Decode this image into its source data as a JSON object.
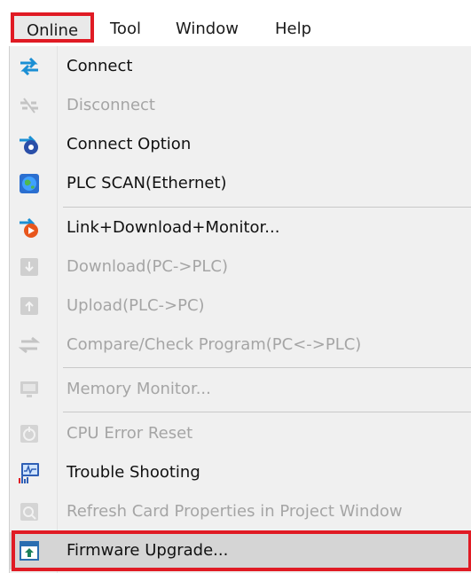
{
  "menubar": {
    "items": [
      {
        "label": "Online"
      },
      {
        "label": "Tool"
      },
      {
        "label": "Window"
      },
      {
        "label": "Help"
      }
    ]
  },
  "menu": {
    "items": [
      {
        "label": "Connect",
        "enabled": true,
        "icon": "connect-arrows-icon"
      },
      {
        "label": "Disconnect",
        "enabled": false,
        "icon": "disconnect-icon"
      },
      {
        "label": "Connect Option",
        "enabled": true,
        "icon": "connect-option-icon"
      },
      {
        "label": "PLC SCAN(Ethernet)",
        "enabled": true,
        "icon": "globe-icon"
      },
      {
        "label": "Link+Download+Monitor...",
        "enabled": true,
        "icon": "link-download-monitor-icon"
      },
      {
        "label": "Download(PC->PLC)",
        "enabled": false,
        "icon": "download-icon"
      },
      {
        "label": "Upload(PLC->PC)",
        "enabled": false,
        "icon": "upload-icon"
      },
      {
        "label": "Compare/Check Program(PC<->PLC)",
        "enabled": false,
        "icon": "compare-icon"
      },
      {
        "label": "Memory Monitor...",
        "enabled": false,
        "icon": "monitor-icon"
      },
      {
        "label": "CPU Error Reset",
        "enabled": false,
        "icon": "reset-icon"
      },
      {
        "label": "Trouble Shooting",
        "enabled": true,
        "icon": "trouble-shooting-icon"
      },
      {
        "label": "Refresh Card Properties in Project Window",
        "enabled": false,
        "icon": "refresh-card-icon"
      },
      {
        "label": "Firmware Upgrade...",
        "enabled": true,
        "icon": "firmware-upgrade-icon"
      }
    ]
  },
  "colors": {
    "highlight_frame": "#e01b24",
    "menu_background": "#f0f0f0",
    "disabled_text": "#a5a5a5"
  }
}
